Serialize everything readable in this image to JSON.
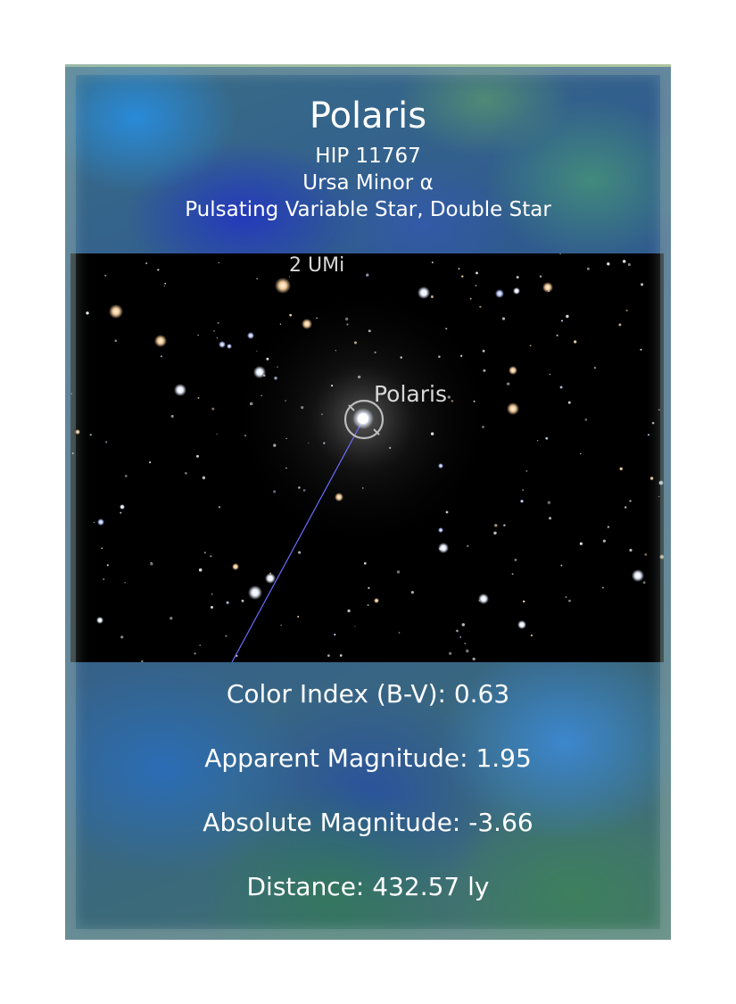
{
  "star": {
    "name": "Polaris",
    "catalog_id": "HIP 11767",
    "constellation": "Ursa Minor α",
    "type": "Pulsating Variable Star, Double Star"
  },
  "sky_map": {
    "labels": {
      "target": "Polaris",
      "neighbor": "2 UMi"
    }
  },
  "stats": {
    "color_index": "Color Index (B-V): 0.63",
    "apparent_magnitude": "Apparent Magnitude: 1.95",
    "absolute_magnitude": "Absolute Magnitude: -3.66",
    "distance": "Distance: 432.57 ly"
  },
  "colors": {
    "sky_background": "#000000",
    "constellation_line": "#6b6bff",
    "text": "#ffffff",
    "label_text": "#d8d8d8"
  }
}
